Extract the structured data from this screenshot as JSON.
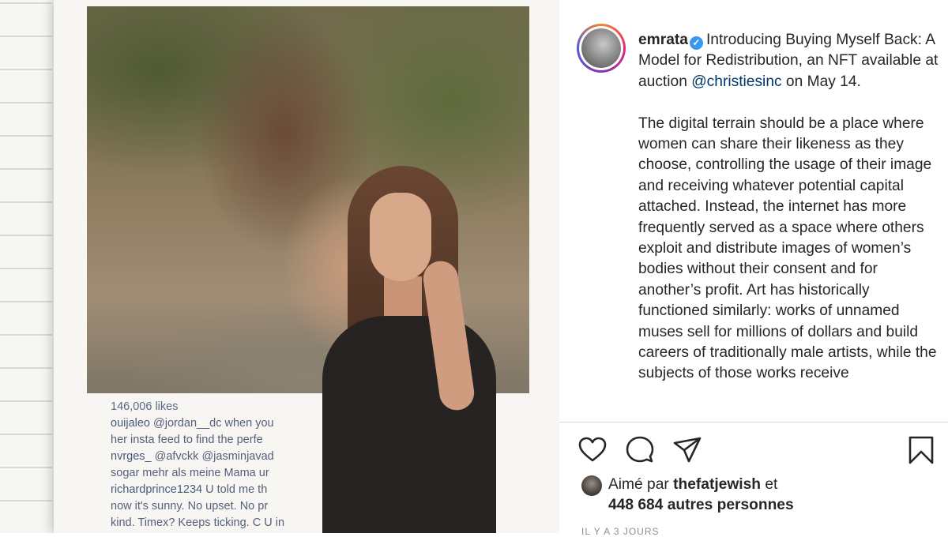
{
  "post": {
    "username": "emrata",
    "verified_glyph": "✓",
    "caption_intro": "Introducing Buying Myself Back: A Model for Redistribution, an NFT available at auction ",
    "caption_mention": "@christiesinc",
    "caption_intro_end": " on May 14.",
    "caption_body": "The digital terrain should be a place where women can share their likeness as they choose, controlling the usage of their image and receiving whatever potential capital attached. Instead, the internet has more frequently served as a space where others exploit and distribute images of women’s bodies without their consent and for another’s profit. Art has historically functioned similarly: works of unnamed muses sell for millions of dollars and build careers of traditionally male artists, while the subjects of those works receive",
    "liked_prefix": "Aimé par ",
    "liked_user": "thefatjewish",
    "liked_suffix": " et",
    "liked_others": "448 684 autres personnes",
    "time_ago": "IL Y A 3 JOURS",
    "icons": [
      "like-heart-icon",
      "comment-icon",
      "share-icon",
      "save-bookmark-icon"
    ]
  },
  "poster": {
    "likes": "146,006 likes",
    "comments": [
      {
        "user": "ouijaleo",
        "text": " @jordan__dc when you"
      },
      {
        "user": "",
        "text": "her insta feed to find the perfe"
      },
      {
        "user": "nvrges_",
        "text": " @afvckk @jasminjavad"
      },
      {
        "user": "",
        "text": "sogar mehr als meine Mama ur"
      },
      {
        "user": "richardprince1234",
        "text": " U told me th"
      },
      {
        "user": "",
        "text": "now it's sunny. No upset. No pr"
      },
      {
        "user": "",
        "text": "kind. Timex? Keeps ticking. C U in"
      }
    ]
  },
  "colors": {
    "link": "#00376b",
    "verified": "#3897f0",
    "text": "#262626",
    "muted": "#8e8e8e"
  }
}
